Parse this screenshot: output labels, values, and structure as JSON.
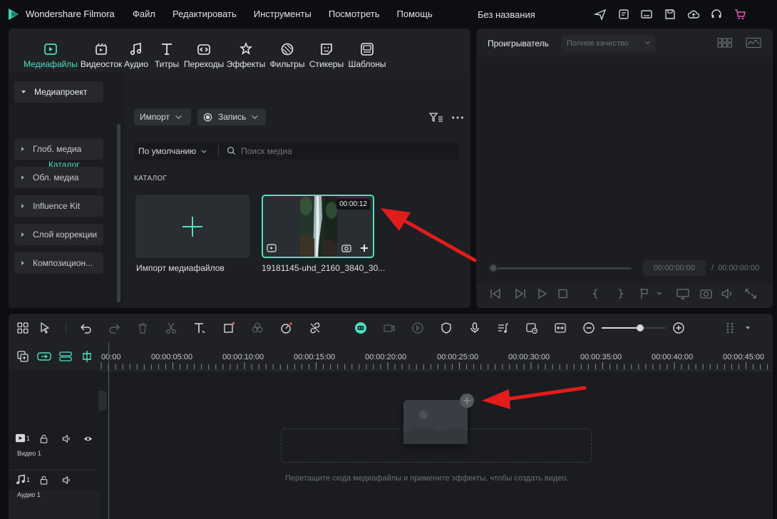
{
  "app": {
    "title": "Wondershare Filmora",
    "document_title": "Без названия",
    "menu": [
      "Файл",
      "Редактировать",
      "Инструменты",
      "Посмотреть",
      "Помощь"
    ],
    "title_icons": [
      "send-icon",
      "report-icon",
      "monitor-icon",
      "save-icon",
      "cloud-icon",
      "headset-icon",
      "cart-icon"
    ],
    "accent": "#4fe0c2"
  },
  "media_tabs": [
    {
      "label": "Медиафайлы",
      "icon": "media-icon",
      "active": true
    },
    {
      "label": "Видеосток",
      "icon": "stock-video-icon"
    },
    {
      "label": "Аудио",
      "icon": "music-note-icon"
    },
    {
      "label": "Титры",
      "icon": "text-t-icon"
    },
    {
      "label": "Переходы",
      "icon": "transition-icon"
    },
    {
      "label": "Эффекты",
      "icon": "effects-icon"
    },
    {
      "label": "Фильтры",
      "icon": "filter-icon"
    },
    {
      "label": "Стикеры",
      "icon": "sticker-icon"
    },
    {
      "label": "Шаблоны",
      "icon": "template-icon"
    }
  ],
  "sidebar": {
    "items": [
      {
        "label": "Медиапроект",
        "expanded": true
      },
      {
        "label": "Глоб. медиа"
      },
      {
        "label": "Обл. медиа"
      },
      {
        "label": "Influence Kit"
      },
      {
        "label": "Слой коррекции"
      },
      {
        "label": "Композицион..."
      }
    ],
    "sub_item": "Каталог"
  },
  "media": {
    "import_label": "Импорт",
    "record_label": "Запись",
    "sort_label": "По умолчанию",
    "search_placeholder": "Поиск медиа",
    "catalog_heading": "КАТАЛОГ",
    "import_tile_label": "Импорт медиафайлов",
    "clip": {
      "name": "19181145-uhd_2160_3840_30...",
      "duration": "00:00:12"
    }
  },
  "player": {
    "title": "Проигрыватель",
    "quality": "Полное качество",
    "current_time": "00:00:00:00",
    "separator": "/",
    "total_time": "00:00:00:00"
  },
  "timeline": {
    "ruler": [
      "00:00",
      "00:00:05:00",
      "00:00:10:00",
      "00:00:15:00",
      "00:00:20:00",
      "00:00:25:00",
      "00:00:30:00",
      "00:00:35:00",
      "00:00:40:00",
      "00:00:45:00"
    ],
    "tracks": [
      {
        "label": "Видео 1",
        "num": "1",
        "type": "video"
      },
      {
        "label": "Аудио 1",
        "num": "1",
        "type": "audio"
      }
    ],
    "drop_hint": "Перетащите сюда медиафайлы и примените эффекты, чтобы создать видео."
  }
}
